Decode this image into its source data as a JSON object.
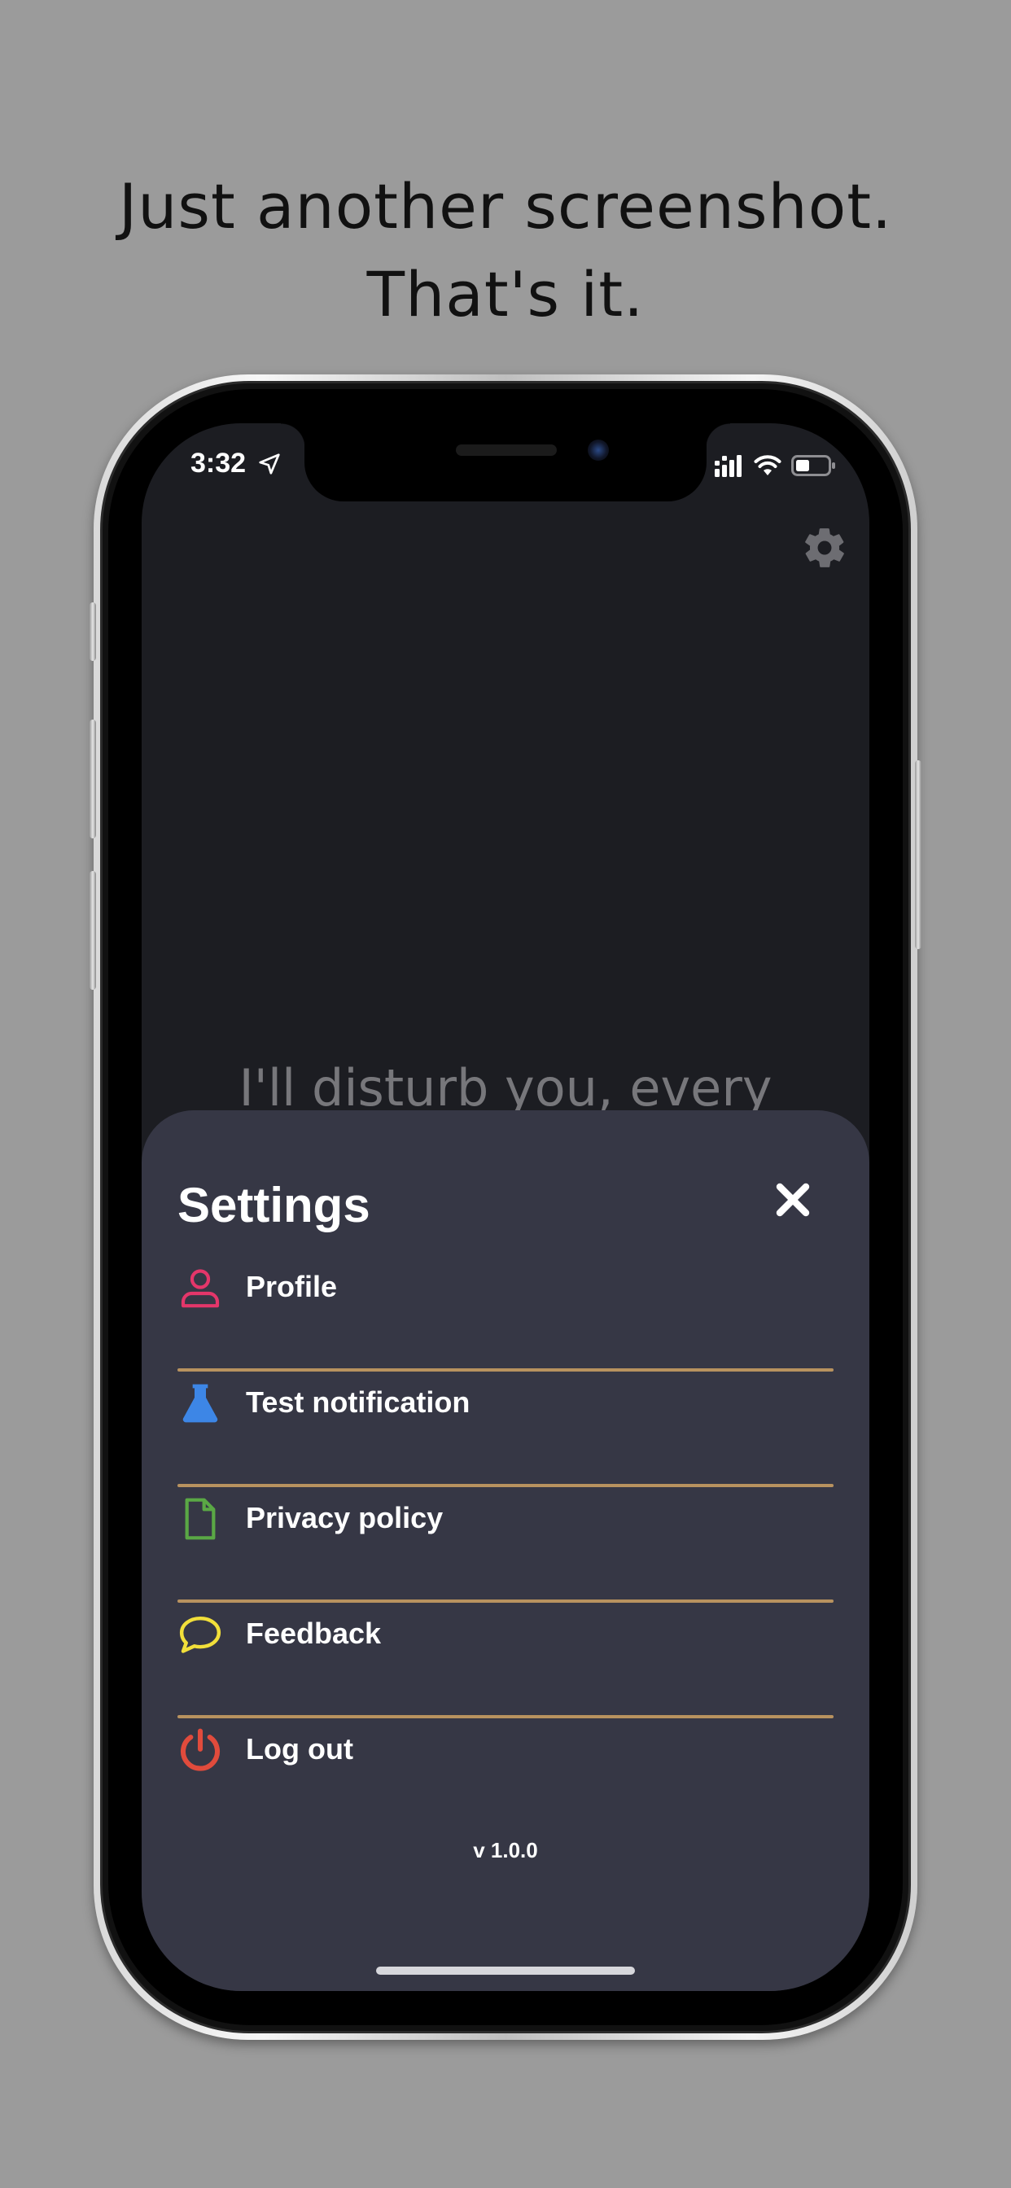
{
  "headline": {
    "line1": "Just another screenshot.",
    "line2": "That's it."
  },
  "status_bar": {
    "time": "3:32",
    "icons": [
      "location-arrow-icon",
      "signal-icon",
      "wifi-icon",
      "battery-icon"
    ]
  },
  "background": {
    "text": "I'll disturb you, every"
  },
  "settings": {
    "title": "Settings",
    "close_icon": "close-icon",
    "items": [
      {
        "label": "Profile",
        "icon": "user-icon",
        "color": "#e4366a"
      },
      {
        "label": "Test notification",
        "icon": "flask-icon",
        "color": "#3d86e6"
      },
      {
        "label": "Privacy policy",
        "icon": "document-icon",
        "color": "#5aa845"
      },
      {
        "label": "Feedback",
        "icon": "speech-bubble-icon",
        "color": "#f2df3a"
      },
      {
        "label": "Log out",
        "icon": "power-icon",
        "color": "#e14b3c"
      }
    ],
    "version": "v 1.0.0"
  },
  "colors": {
    "page_background": "#9b9b9b",
    "screen_background": "#1c1d22",
    "sheet_background": "#363745",
    "divider": "#b8925f"
  }
}
